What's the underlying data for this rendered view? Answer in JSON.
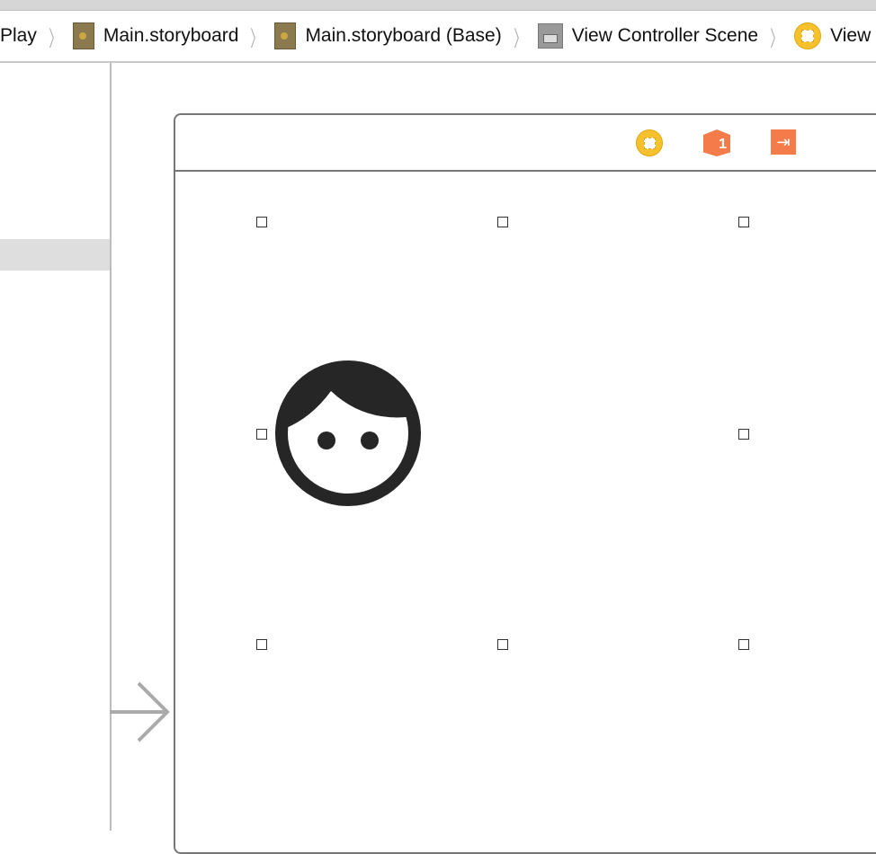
{
  "breadcrumb": [
    {
      "label": "Play",
      "icon": "none"
    },
    {
      "label": "Main.storyboard",
      "icon": "storyboard-file-icon"
    },
    {
      "label": "Main.storyboard (Base)",
      "icon": "storyboard-file-icon"
    },
    {
      "label": "View Controller Scene",
      "icon": "scene-icon"
    },
    {
      "label": "View",
      "icon": "view-controller-icon"
    }
  ],
  "scene": {
    "first_responder_badge": "1",
    "icons": [
      "view-controller-icon",
      "first-responder-icon",
      "exit-icon"
    ]
  },
  "colors": {
    "accent_yellow": "#f6c12d",
    "accent_orange": "#f47c4a",
    "face": "#262626"
  }
}
